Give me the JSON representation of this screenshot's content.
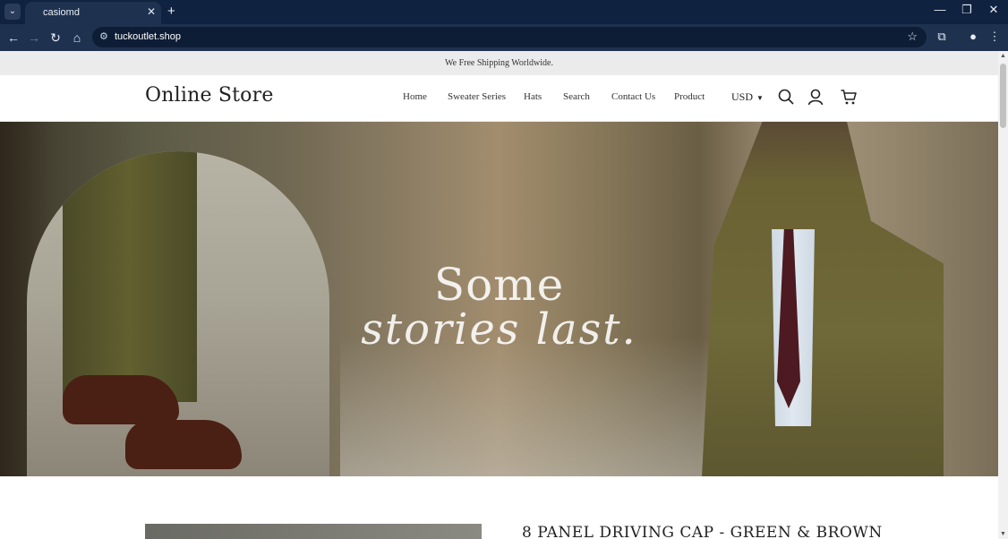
{
  "browser": {
    "tab_title": "casiomd",
    "url": "tuckoutlet.shop"
  },
  "announcement": "We Free Shipping Worldwide.",
  "header": {
    "logo": "Online Store",
    "nav": [
      "Home",
      "Sweater Series",
      "Hats",
      "Search",
      "Contact Us",
      "Product"
    ],
    "currency": "USD",
    "icons": [
      "search-icon",
      "account-icon",
      "cart-icon"
    ]
  },
  "hero": {
    "line1": "Some",
    "line2": "stories last."
  },
  "product": {
    "title": "8 PANEL DRIVING CAP - GREEN & BROWN"
  },
  "colors": {
    "chrome_dark": "#0f2240",
    "chrome_toolbar": "#1e3250",
    "announcement_bg": "#ebebeb"
  }
}
